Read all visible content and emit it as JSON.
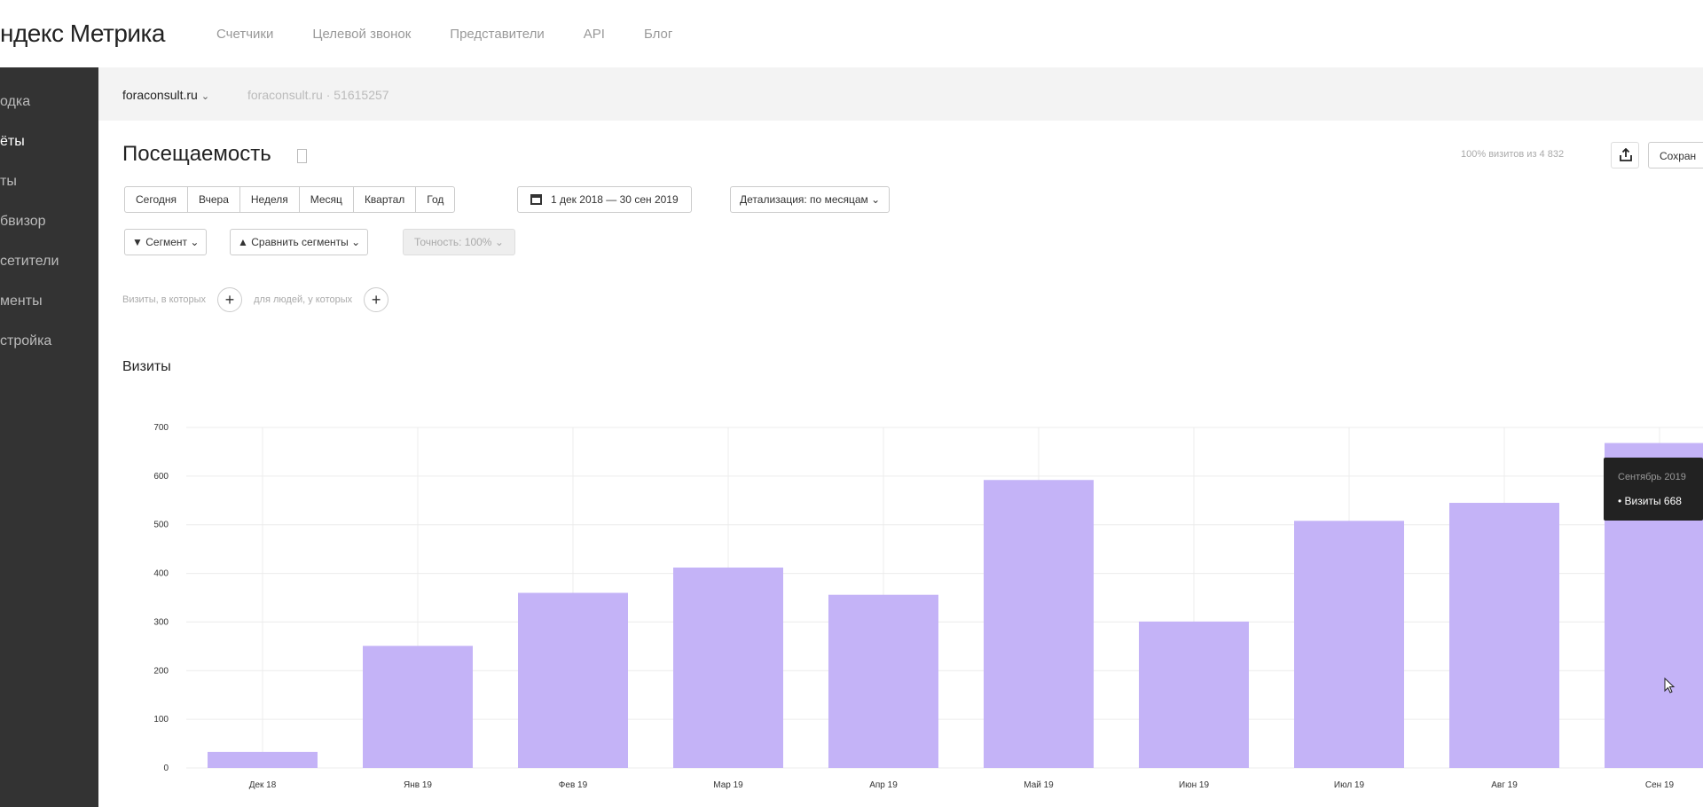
{
  "header": {
    "logo": "ндекс Метрика",
    "nav": [
      "Счетчики",
      "Целевой звонок",
      "Представители",
      "API",
      "Блог"
    ]
  },
  "sidebar": {
    "items": [
      {
        "label": "одка",
        "active": false
      },
      {
        "label": "ёты",
        "active": true
      },
      {
        "label": "ты",
        "active": false
      },
      {
        "label": "бвизор",
        "active": false
      },
      {
        "label": "сетители",
        "active": false
      },
      {
        "label": "менты",
        "active": false
      },
      {
        "label": "стройка",
        "active": false
      }
    ]
  },
  "counter": {
    "selected": "foraconsult.ru",
    "id_text": "foraconsult.ru · 51615257"
  },
  "page": {
    "title": "Посещаемость",
    "sample_info": "100% визитов из 4 832",
    "save_label": "Сохран"
  },
  "period_buttons": [
    "Сегодня",
    "Вчера",
    "Неделя",
    "Месяц",
    "Квартал",
    "Год"
  ],
  "date_range": "1 дек 2018 — 30 сен 2019",
  "detail": "Детализация: по месяцам",
  "segment_label": "Сегмент",
  "compare_label": "Сравнить сегменты",
  "accuracy_label": "Точность: 100%",
  "filters": {
    "visits_label": "Визиты, в которых",
    "people_label": "для людей, у которых"
  },
  "chart_title": "Визиты",
  "tooltip": {
    "title": "Сентябрь 2019",
    "row": "• Визиты 668"
  },
  "colors": {
    "bar": "#c4b3f7",
    "sidebar": "#333333",
    "tooltip": "#222222"
  },
  "chart_data": {
    "type": "bar",
    "categories": [
      "Дек 18",
      "Янв 19",
      "Фев 19",
      "Мар 19",
      "Апр 19",
      "Май 19",
      "Июн 19",
      "Июл 19",
      "Авг 19",
      "Сен 19"
    ],
    "series": [
      {
        "name": "Визиты",
        "values": [
          33,
          251,
          360,
          412,
          356,
          592,
          301,
          508,
          545,
          668
        ]
      }
    ],
    "yticks": [
      0,
      100,
      200,
      300,
      400,
      500,
      600,
      700
    ],
    "ylim": [
      0,
      700
    ],
    "grid": true,
    "legend": "none"
  }
}
